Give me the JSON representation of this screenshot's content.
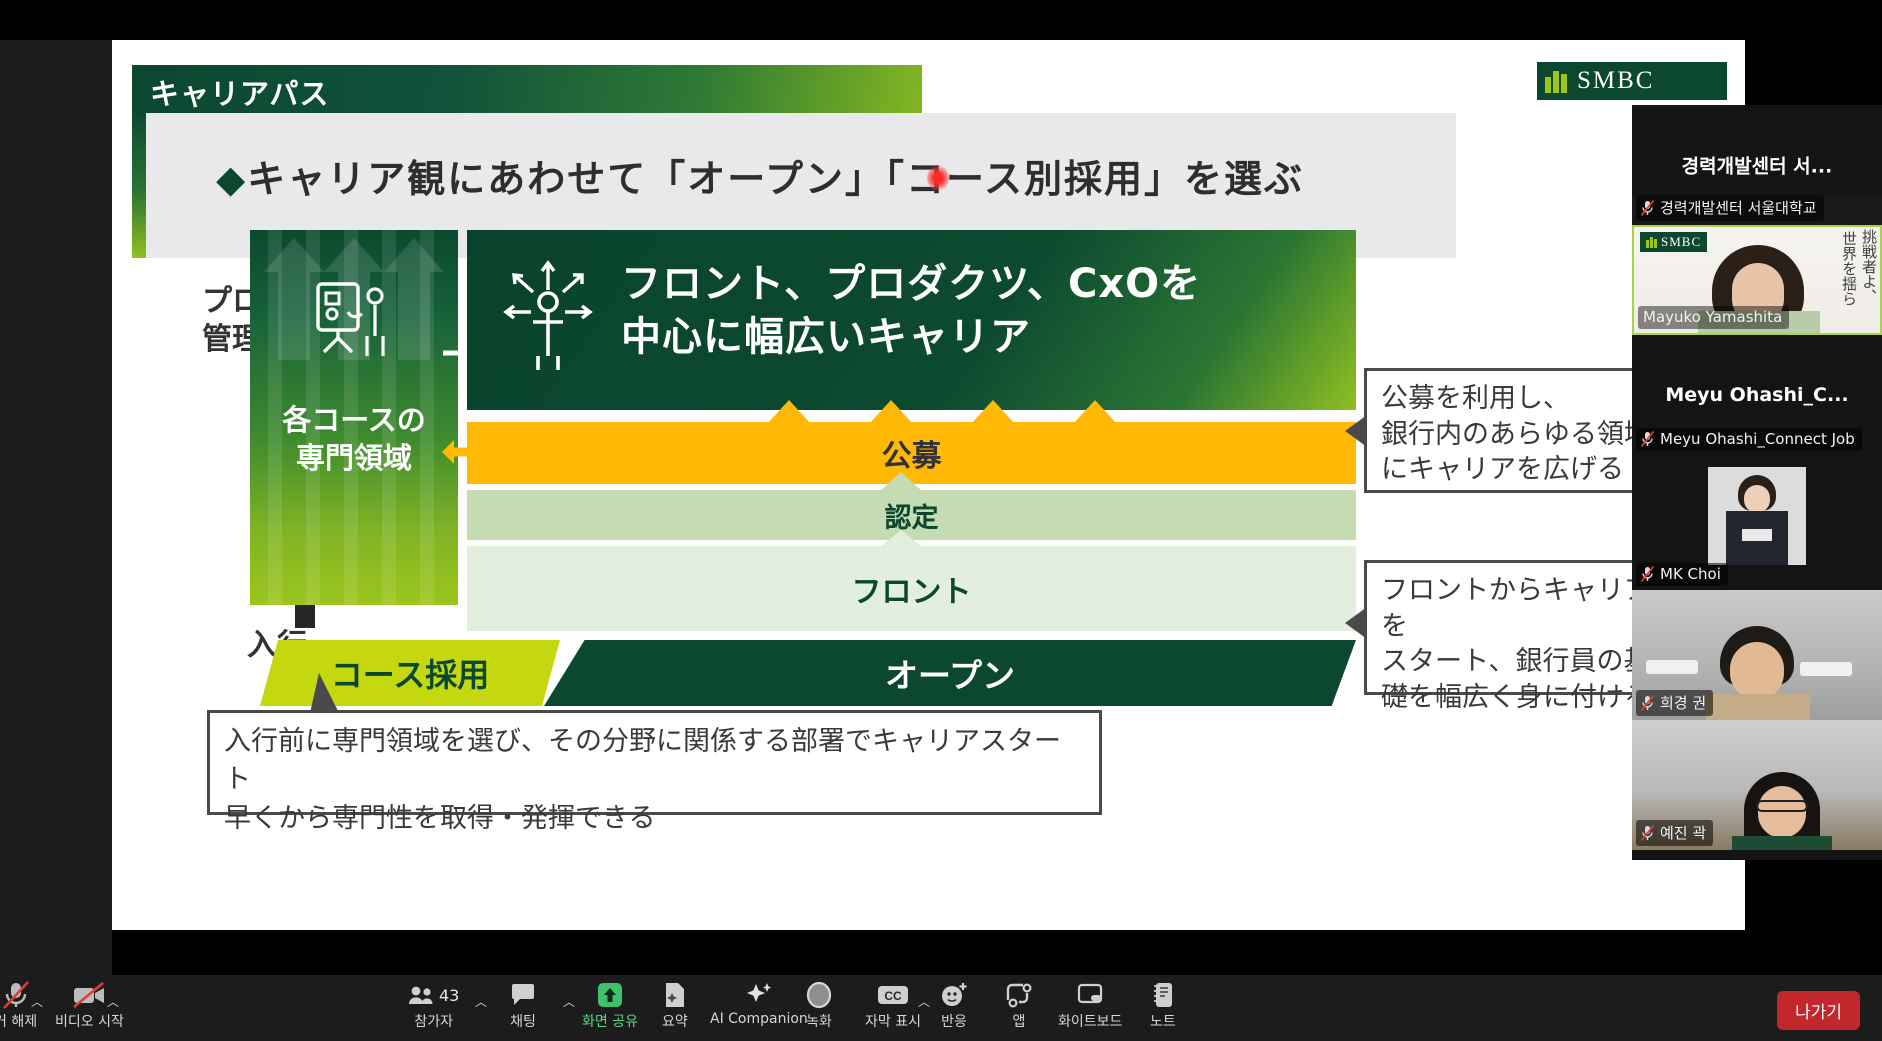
{
  "slide": {
    "header_title": "キャリアパス",
    "subtitle_diamond": "◆",
    "subtitle": "キャリア観にあわせて「オープン」「コース別採用」を選ぶ",
    "logo_text": "SMBC",
    "axis_top_label": "プロ・\n管理職",
    "axis_bottom_label": "入行",
    "course_column_label": "各コースの\n専門領域",
    "green_panel_text": "フロント、プロダクツ、CxOを\n中心に幅広いキャリア",
    "bands": [
      {
        "key": "kobo",
        "label": "公募"
      },
      {
        "key": "nintei",
        "label": "認定"
      },
      {
        "key": "front",
        "label": "フロント"
      }
    ],
    "footer_bars": [
      {
        "key": "course",
        "label": "コース採用"
      },
      {
        "key": "open",
        "label": "オープン"
      }
    ],
    "callouts": [
      {
        "key": "kobo-callout",
        "text": "公募を利用し、\n銀行内のあらゆる領域\nにキャリアを広げる"
      },
      {
        "key": "front-callout",
        "text": "フロントからキャリアを\nスタート、銀行員の基\n礎を幅広く身に付ける"
      },
      {
        "key": "course-callout",
        "text": "入行前に専門領域を選び、その分野に関係する部署でキャリアスタート\n早くから専門性を取得・発揮できる"
      }
    ],
    "colors": {
      "dark_green": "#0c4730",
      "light_green": "#9cc61c",
      "yellow": "#ffb803",
      "mid_green_band": "#c5dbb1",
      "pale_green_band": "#e2eede",
      "lime": "#c5d80f"
    }
  },
  "rail": {
    "participants": [
      {
        "key": "p1",
        "center_name": "경력개발센터 서...",
        "name": "경력개발센터 서울대학교",
        "muted": true,
        "video": false
      },
      {
        "key": "p2",
        "center_name": "",
        "name": "Mayuko Yamashita",
        "muted": false,
        "video": true,
        "overlay_smbc": "SMBC",
        "kanji_a": "挑戦者よ、",
        "kanji_b": "世界を揺ら"
      },
      {
        "key": "p3",
        "center_name": "Meyu  Ohashi_C...",
        "name": "Meyu Ohashi_Connect Job",
        "muted": true,
        "video": false
      },
      {
        "key": "p4",
        "center_name": "",
        "name": "MK Choi",
        "muted": true,
        "video": true
      },
      {
        "key": "p5",
        "center_name": "",
        "name": "희경 권",
        "muted": true,
        "video": true
      },
      {
        "key": "p6",
        "center_name": "",
        "name": "예진 곽",
        "muted": true,
        "video": true
      }
    ]
  },
  "toolbar": {
    "mic": {
      "label": "거 해제",
      "icon": "mic-off-icon"
    },
    "video": {
      "label": "비디오 시작",
      "icon": "video-off-icon"
    },
    "participants": {
      "label": "참가자",
      "count": "43",
      "icon": "people-icon"
    },
    "chat": {
      "label": "채팅",
      "icon": "chat-icon"
    },
    "share": {
      "label": "화면 공유",
      "icon": "share-screen-icon"
    },
    "summary": {
      "label": "요약",
      "icon": "summary-doc-icon"
    },
    "companion": {
      "label": "AI Companion",
      "icon": "sparkle-icon"
    },
    "record": {
      "label": "녹화",
      "icon": "record-icon"
    },
    "captions": {
      "label": "자막 표시",
      "icon": "cc-icon"
    },
    "reactions": {
      "label": "반응",
      "icon": "smiley-plus-icon"
    },
    "apps": {
      "label": "앱",
      "icon": "apps-icon"
    },
    "whiteboard": {
      "label": "화이트보드",
      "icon": "whiteboard-icon"
    },
    "notes": {
      "label": "노트",
      "icon": "notes-icon"
    },
    "leave": {
      "label": "나가기"
    }
  }
}
